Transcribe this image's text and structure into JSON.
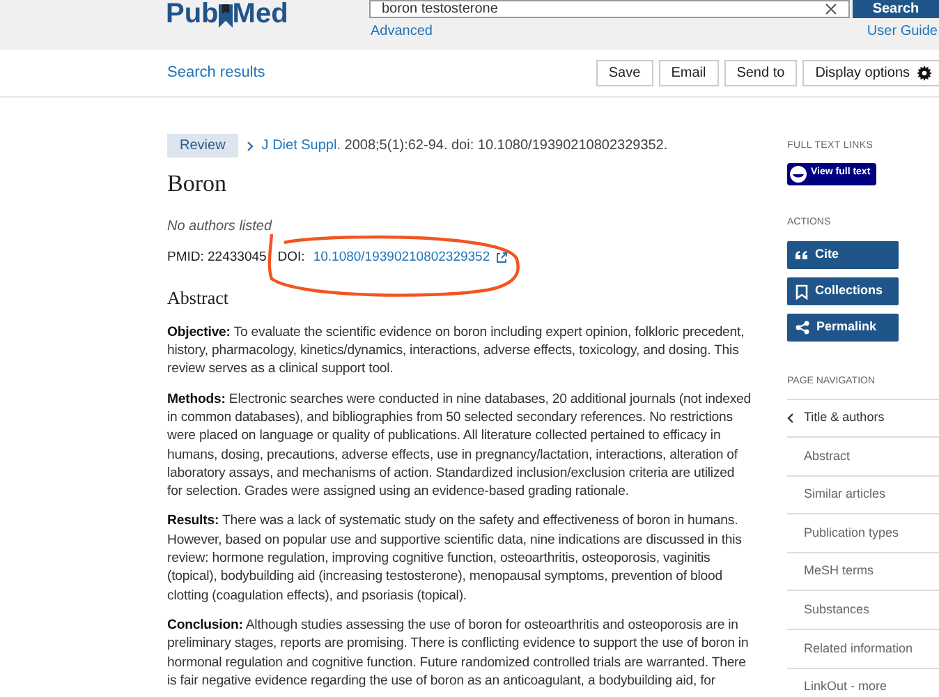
{
  "header": {
    "logo": [
      "Pub",
      "Med"
    ],
    "search_value": "boron testosterone",
    "search_button": "Search",
    "advanced": "Advanced",
    "user_guide": "User Guide"
  },
  "toolbar": {
    "back_link": "Search results",
    "buttons": [
      {
        "label": "Save",
        "kind": "plain"
      },
      {
        "label": "Email",
        "kind": "plain"
      },
      {
        "label": "Send to",
        "kind": "plain"
      },
      {
        "label": "Display options",
        "kind": "gear"
      }
    ]
  },
  "article": {
    "type_badge": "Review",
    "journal": "J Diet Suppl.",
    "citation": "2008;5(1):62-94. doi: 10.1080/19390210802329352.",
    "title": "Boron",
    "authors": "No authors listed",
    "pmid": "PMID: 22433045",
    "doi_label": "DOI:",
    "doi": "10.1080/19390210802329352",
    "abstract_heading": "Abstract",
    "abstract": [
      {
        "label": "Objective:",
        "text": "To evaluate the scientific evidence on boron including expert opinion, folkloric precedent, history, pharmacology, kinetics/dynamics, interactions, adverse effects, toxicology, and dosing. This review serves as a clinical support tool."
      },
      {
        "label": "Methods:",
        "text": "Electronic searches were conducted in nine databases, 20 additional journals (not indexed in common databases), and bibliographies from 50 selected secondary references. No restrictions were placed on language or quality of publications. All literature collected pertained to efficacy in humans, dosing, precautions, adverse effects, use in pregnancy/lactation, interactions, alteration of laboratory assays, and mechanisms of action. Standardized inclusion/exclusion criteria are utilized for selection. Grades were assigned using an evidence-based grading rationale."
      },
      {
        "label": "Results:",
        "text": "There was a lack of systematic study on the safety and effectiveness of boron in humans. However, based on popular use and supportive scientific data, nine indications are discussed in this review: hormone regulation, improving cognitive function, osteoarthritis, osteoporosis, vaginitis (topical), bodybuilding aid (increasing testosterone), menopausal symptoms, prevention of blood clotting (coagulation effects), and psoriasis (topical)."
      },
      {
        "label": "Conclusion:",
        "text": "Although studies assessing the use of boron for osteoarthritis and osteoporosis are in preliminary stages, reports are promising. There is conflicting evidence to support the use of boron in hormonal regulation and cognitive function. Future randomized controlled trials are warranted. There is fair negative evidence regarding the use of boron as an anticoagulant, a bodybuilding aid, for"
      }
    ]
  },
  "sidebar": {
    "full_text_heading": "FULL TEXT LINKS",
    "full_text_button": "View full text",
    "actions_heading": "ACTIONS",
    "actions": [
      {
        "label": "Cite",
        "kind": "quote"
      },
      {
        "label": "Collections",
        "kind": "bookmark"
      },
      {
        "label": "Permalink",
        "kind": "share"
      }
    ],
    "nav_heading": "PAGE NAVIGATION",
    "nav": [
      {
        "label": "Title & authors",
        "selected": true
      },
      {
        "label": "Abstract",
        "selected": false
      },
      {
        "label": "Similar articles",
        "selected": false
      },
      {
        "label": "Publication types",
        "selected": false
      },
      {
        "label": "MeSH terms",
        "selected": false
      },
      {
        "label": "Substances",
        "selected": false
      },
      {
        "label": "Related information",
        "selected": false
      },
      {
        "label": "LinkOut - more",
        "selected": false
      }
    ]
  }
}
